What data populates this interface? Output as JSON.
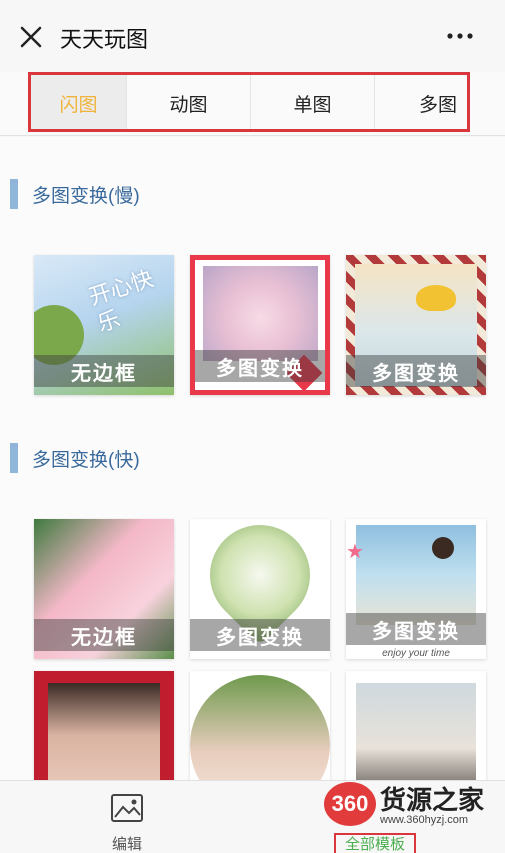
{
  "header": {
    "title": "天天玩图"
  },
  "tabs": [
    {
      "label": "闪图",
      "active": true
    },
    {
      "label": "动图",
      "active": false
    },
    {
      "label": "单图",
      "active": false
    },
    {
      "label": "多图",
      "active": false
    }
  ],
  "sections": [
    {
      "title": "多图变换(慢)",
      "items": [
        {
          "caption": "无边框",
          "overlay_text": "开心快乐",
          "style": "sky"
        },
        {
          "caption": "多图变换",
          "style": "flowers-heart"
        },
        {
          "caption": "多图变换",
          "style": "striped-frame"
        }
      ]
    },
    {
      "title": "多图变换(快)",
      "items": [
        {
          "caption": "无边框",
          "style": "pink-flowers"
        },
        {
          "caption": "多图变换",
          "style": "heart-blossom"
        },
        {
          "caption": "多图变换",
          "subtext": "enjoy your time",
          "style": "polaroid-girl"
        },
        {
          "caption": "",
          "style": "rose-frame-portrait"
        },
        {
          "caption": "",
          "style": "circle-portrait"
        },
        {
          "caption": "",
          "style": "polaroid-portrait"
        }
      ]
    }
  ],
  "bottom_bar": {
    "edit_label": "编辑",
    "all_templates_label": "全部模板"
  },
  "watermark": {
    "badge": "360",
    "name": "货源之家",
    "url": "www.360hyzj.com"
  },
  "colors": {
    "accent": "#f0b43c",
    "highlight_red": "#d9363e",
    "section_blue": "#3a6a9c"
  }
}
